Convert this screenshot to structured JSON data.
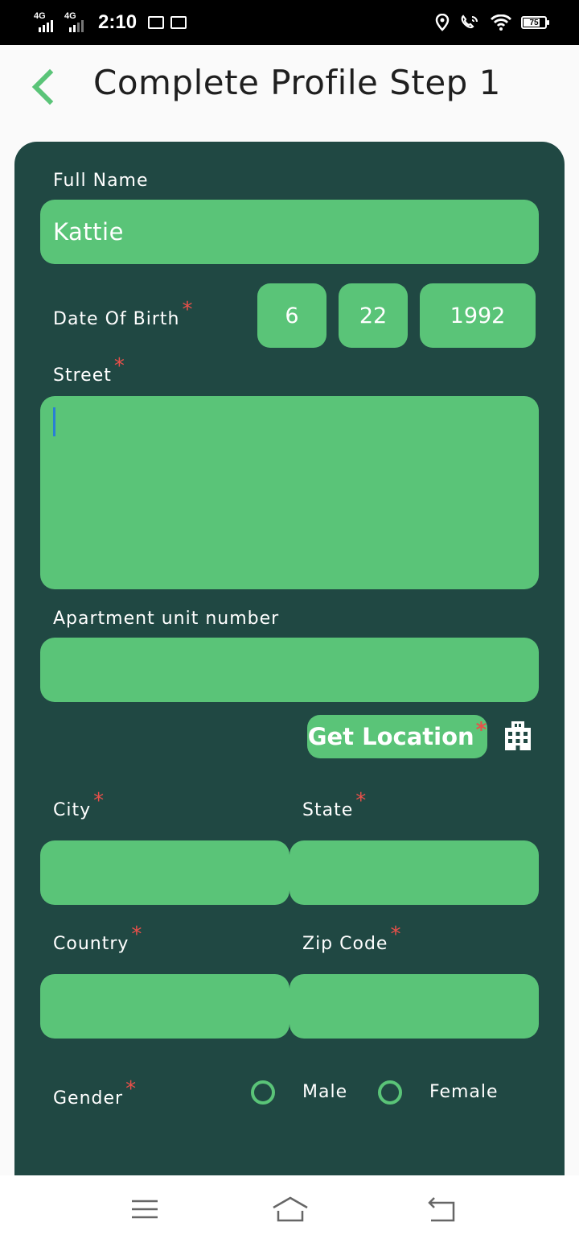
{
  "status_bar": {
    "network1": "4G",
    "network2": "4G",
    "time": "2:10",
    "battery": "75"
  },
  "header": {
    "title": "Complete Profile Step 1"
  },
  "form": {
    "full_name": {
      "label": "Full Name",
      "value": "Kattie"
    },
    "dob": {
      "label": "Date Of Birth",
      "required": "*",
      "month": "6",
      "day": "22",
      "year": "1992"
    },
    "street": {
      "label": "Street",
      "required": "*",
      "value": ""
    },
    "apartment": {
      "label": "Apartment unit number",
      "value": ""
    },
    "get_location": {
      "label": "Get Location",
      "required": "*"
    },
    "city": {
      "label": "City",
      "required": "*",
      "value": ""
    },
    "state": {
      "label": "State",
      "required": "*",
      "value": ""
    },
    "country": {
      "label": "Country",
      "required": "*",
      "value": ""
    },
    "zip": {
      "label": "Zip Code",
      "required": "*",
      "value": ""
    },
    "gender": {
      "label": "Gender",
      "required": "*",
      "options": [
        "Male",
        "Female"
      ]
    }
  },
  "colors": {
    "card": "#204843",
    "field": "#5ac478",
    "required": "#e8504a",
    "accent": "#5ac478"
  },
  "icons": {
    "back": "chevron-left-icon",
    "location": "building-icon",
    "nav_menu": "menu-icon",
    "nav_home": "home-icon",
    "nav_back": "return-icon"
  }
}
